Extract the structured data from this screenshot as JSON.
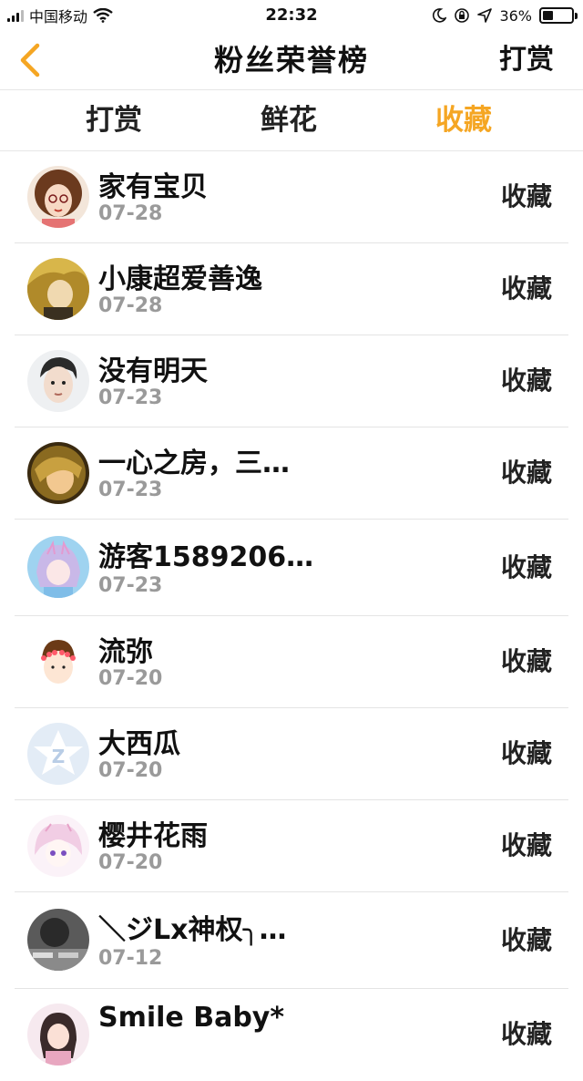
{
  "status_bar": {
    "carrier": "中国移动",
    "time": "22:32",
    "battery": "36%",
    "battery_level": 0.36
  },
  "nav": {
    "title": "粉丝荣誉榜",
    "right_label": "打赏",
    "back_icon": "chevron-left-icon",
    "accent_color": "#f5a623"
  },
  "tabs": [
    {
      "label": "打赏",
      "active": false
    },
    {
      "label": "鲜花",
      "active": false
    },
    {
      "label": "收藏",
      "active": true
    }
  ],
  "fans": [
    {
      "name": "家有宝贝",
      "date": "07-28",
      "action": "收藏"
    },
    {
      "name": "小康超爱善逸",
      "date": "07-28",
      "action": "收藏"
    },
    {
      "name": "没有明天",
      "date": "07-23",
      "action": "收藏"
    },
    {
      "name": "一心之房，三…",
      "date": "07-23",
      "action": "收藏"
    },
    {
      "name": "游客1589206…",
      "date": "07-23",
      "action": "收藏"
    },
    {
      "name": "流弥",
      "date": "07-20",
      "action": "收藏"
    },
    {
      "name": "大西瓜",
      "date": "07-20",
      "action": "收藏"
    },
    {
      "name": "樱井花雨",
      "date": "07-20",
      "action": "收藏"
    },
    {
      "name": "＼ジLx神权╮…",
      "date": "07-12",
      "action": "收藏"
    },
    {
      "name": "Smile Baby*",
      "date": "",
      "action": "收藏"
    }
  ]
}
